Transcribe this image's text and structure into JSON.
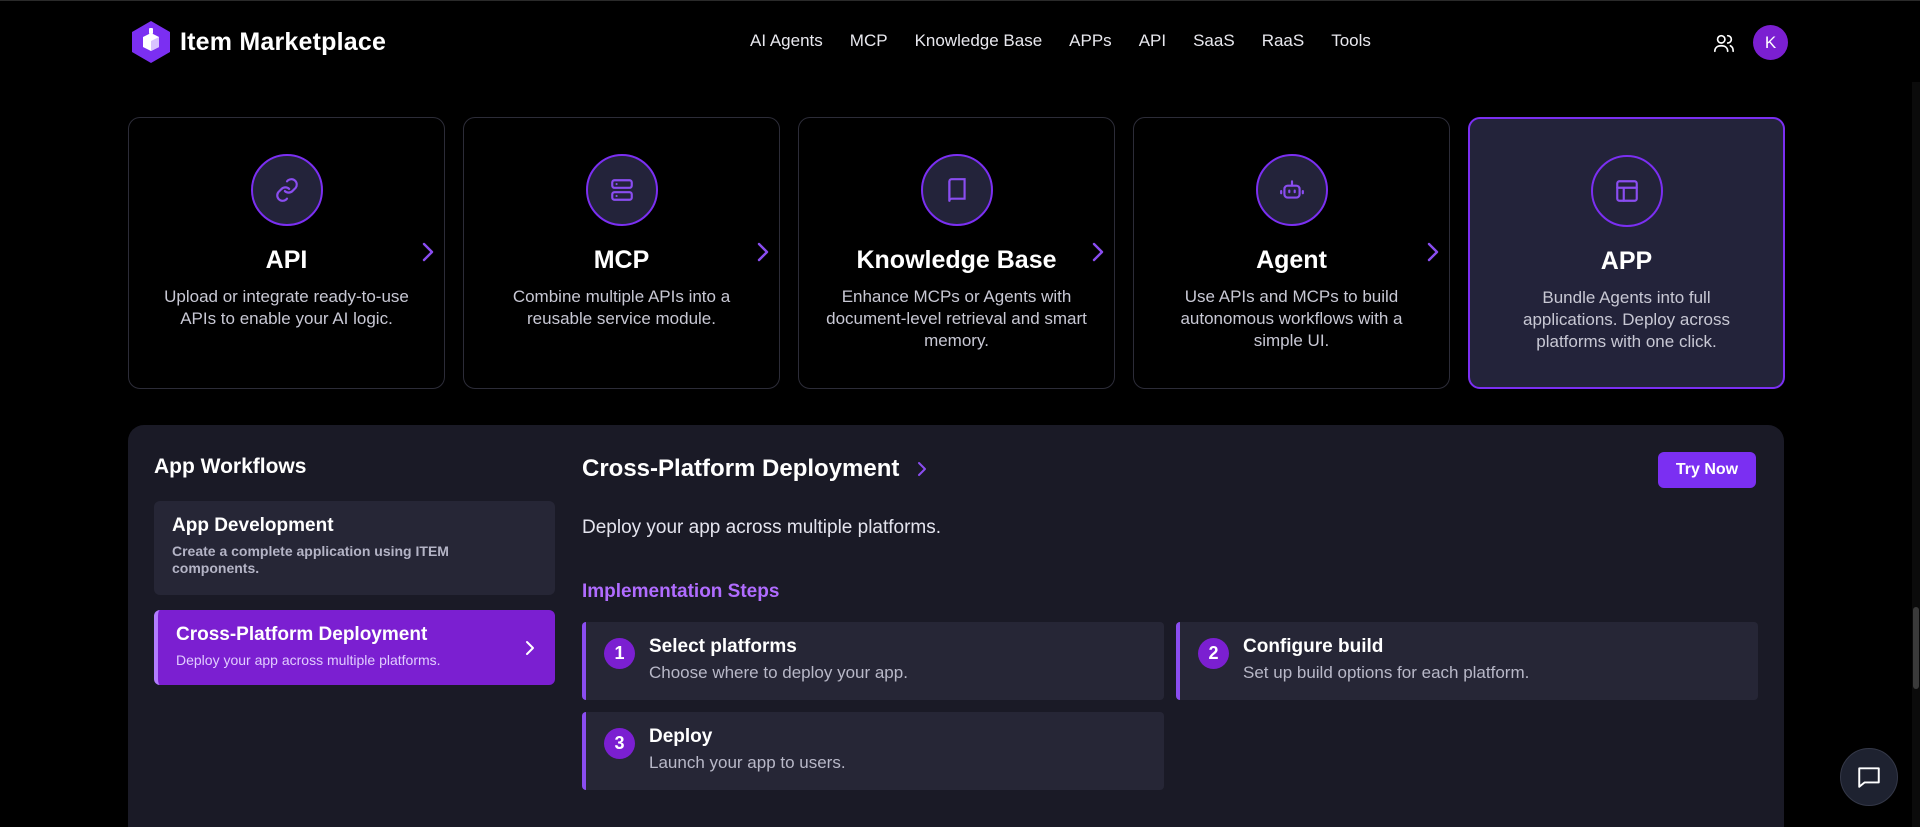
{
  "header": {
    "brand": "Item Marketplace",
    "nav": [
      "AI Agents",
      "MCP",
      "Knowledge Base",
      "APPs",
      "API",
      "SaaS",
      "RaaS",
      "Tools"
    ],
    "avatar_initial": "K",
    "accent_color": "#7b2ff2"
  },
  "cards": [
    {
      "title": "API",
      "desc": "Upload or integrate ready-to-use APIs to enable your AI logic.",
      "icon": "link-icon"
    },
    {
      "title": "MCP",
      "desc": "Combine multiple APIs into a reusable service module.",
      "icon": "server-icon"
    },
    {
      "title": "Knowledge Base",
      "desc": "Enhance MCPs or Agents with document-level retrieval and smart memory.",
      "icon": "book-icon"
    },
    {
      "title": "Agent",
      "desc": "Use APIs and MCPs to build autonomous workflows with a simple UI.",
      "icon": "robot-icon"
    },
    {
      "title": "APP",
      "desc": "Bundle Agents into full applications. Deploy across platforms with one click.",
      "icon": "layout-icon"
    }
  ],
  "workflows": {
    "heading": "App Workflows",
    "items": [
      {
        "title": "App Development",
        "desc": "Create a complete application using ITEM components."
      },
      {
        "title": "Cross-Platform Deployment",
        "desc": "Deploy your app across multiple platforms."
      }
    ]
  },
  "detail": {
    "title": "Cross-Platform Deployment",
    "try_label": "Try Now",
    "desc": "Deploy your app across multiple platforms.",
    "steps_heading": "Implementation Steps",
    "steps": [
      {
        "num": "1",
        "title": "Select platforms",
        "desc": "Choose where to deploy your app."
      },
      {
        "num": "2",
        "title": "Configure build",
        "desc": "Set up build options for each platform."
      },
      {
        "num": "3",
        "title": "Deploy",
        "desc": "Launch your app to users."
      }
    ]
  }
}
